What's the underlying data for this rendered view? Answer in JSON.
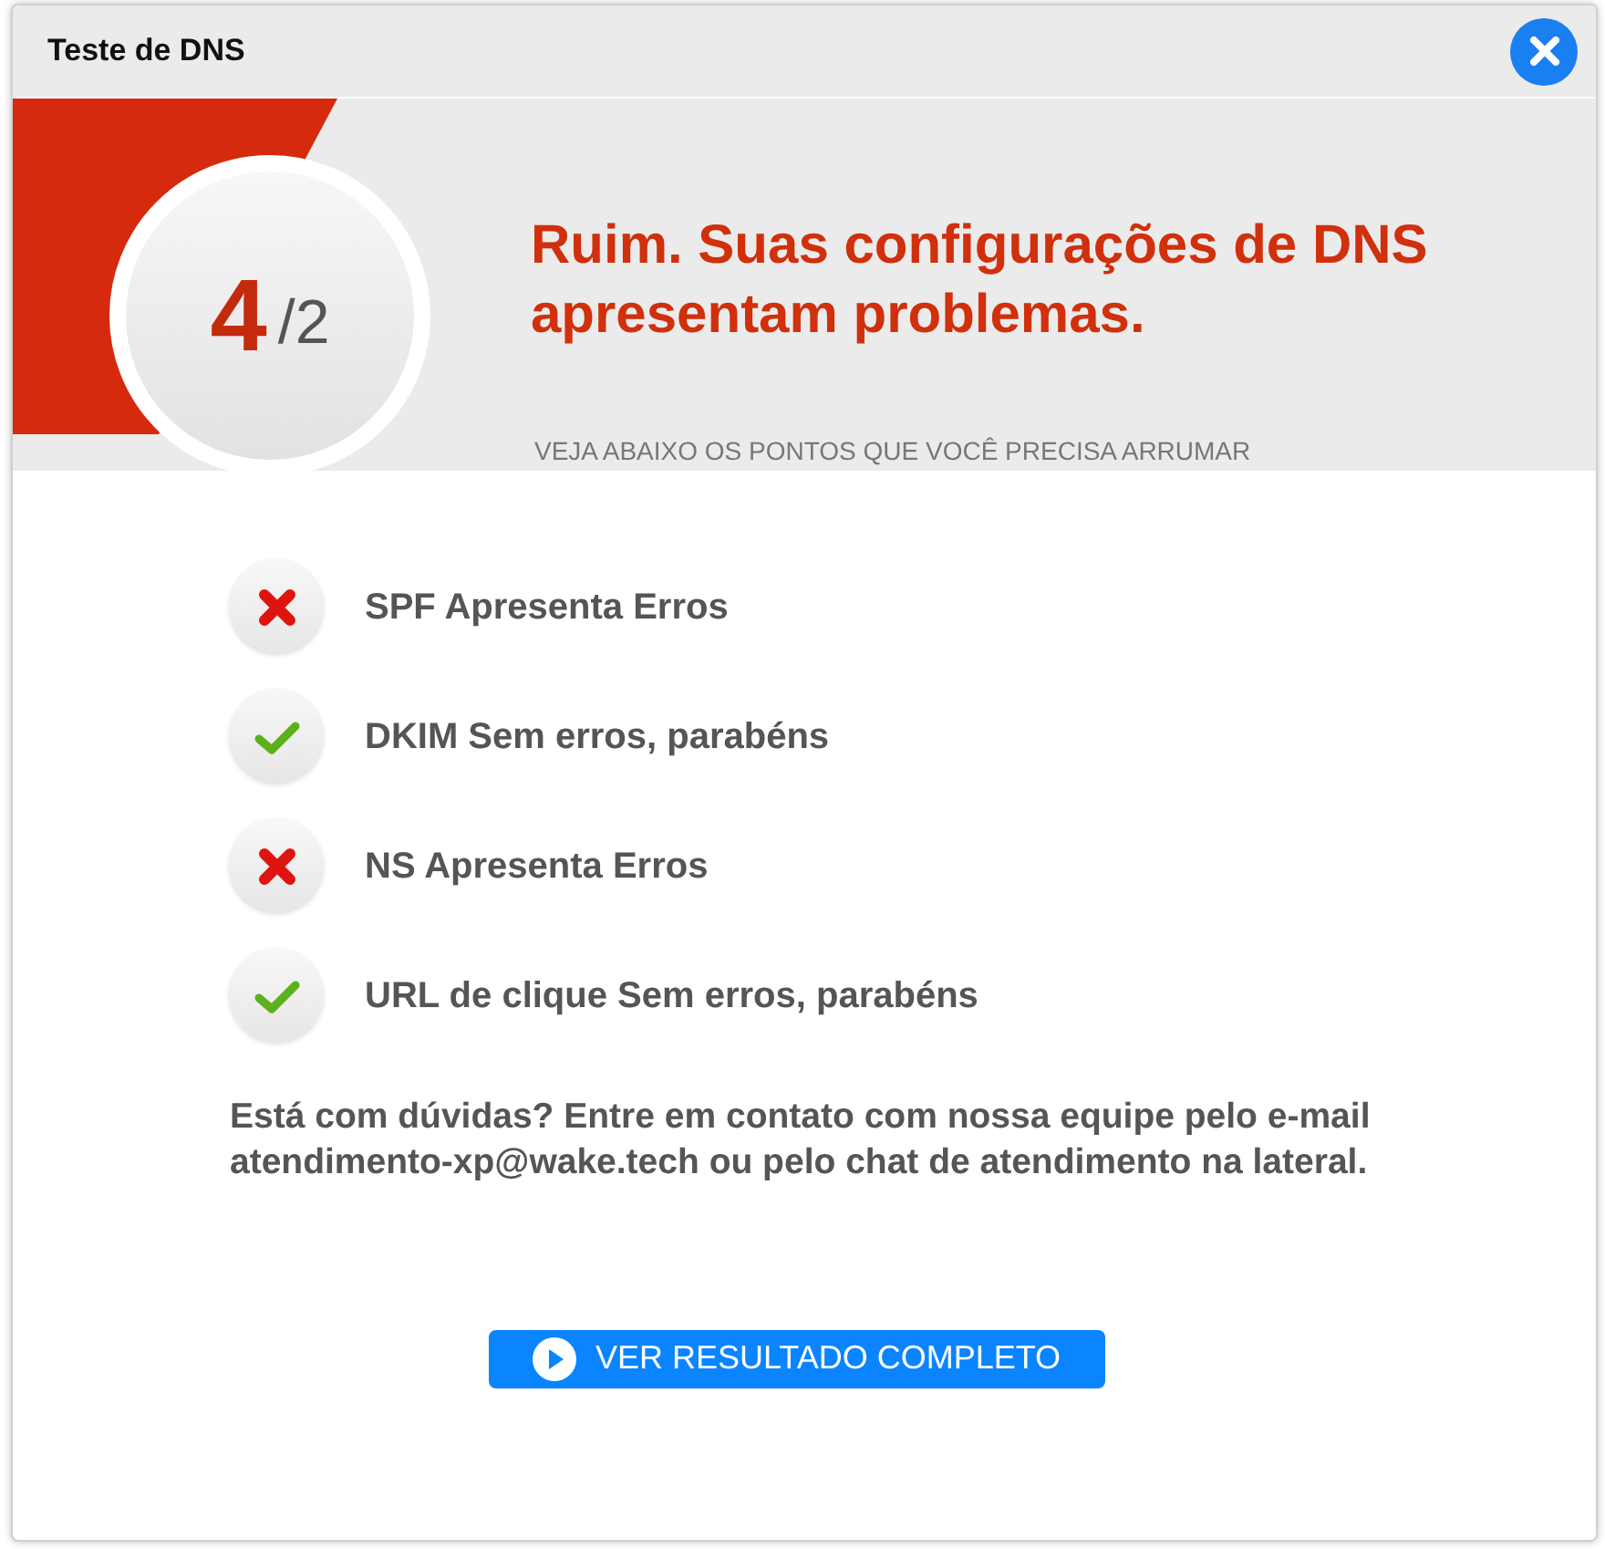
{
  "window": {
    "title": "Teste de DNS"
  },
  "score": {
    "value": "4",
    "total": "/2"
  },
  "headline": "Ruim. Suas configurações de DNS apresentam problemas.",
  "subtitle": "VEJA ABAIXO OS PONTOS QUE VOCÊ PRECISA ARRUMAR",
  "checks": [
    {
      "label": "SPF Apresenta Erros",
      "passed": false
    },
    {
      "label": "DKIM Sem erros, parabéns",
      "passed": true
    },
    {
      "label": "NS Apresenta Erros",
      "passed": false
    },
    {
      "label": "URL de clique Sem erros, parabéns",
      "passed": true
    }
  ],
  "help_text": "Está com dúvidas? Entre em contato com nossa equipe pelo e-mail atendimento-xp@wake.tech ou pelo chat de atendimento na lateral.",
  "button": "VER RESULTADO COMPLETO"
}
